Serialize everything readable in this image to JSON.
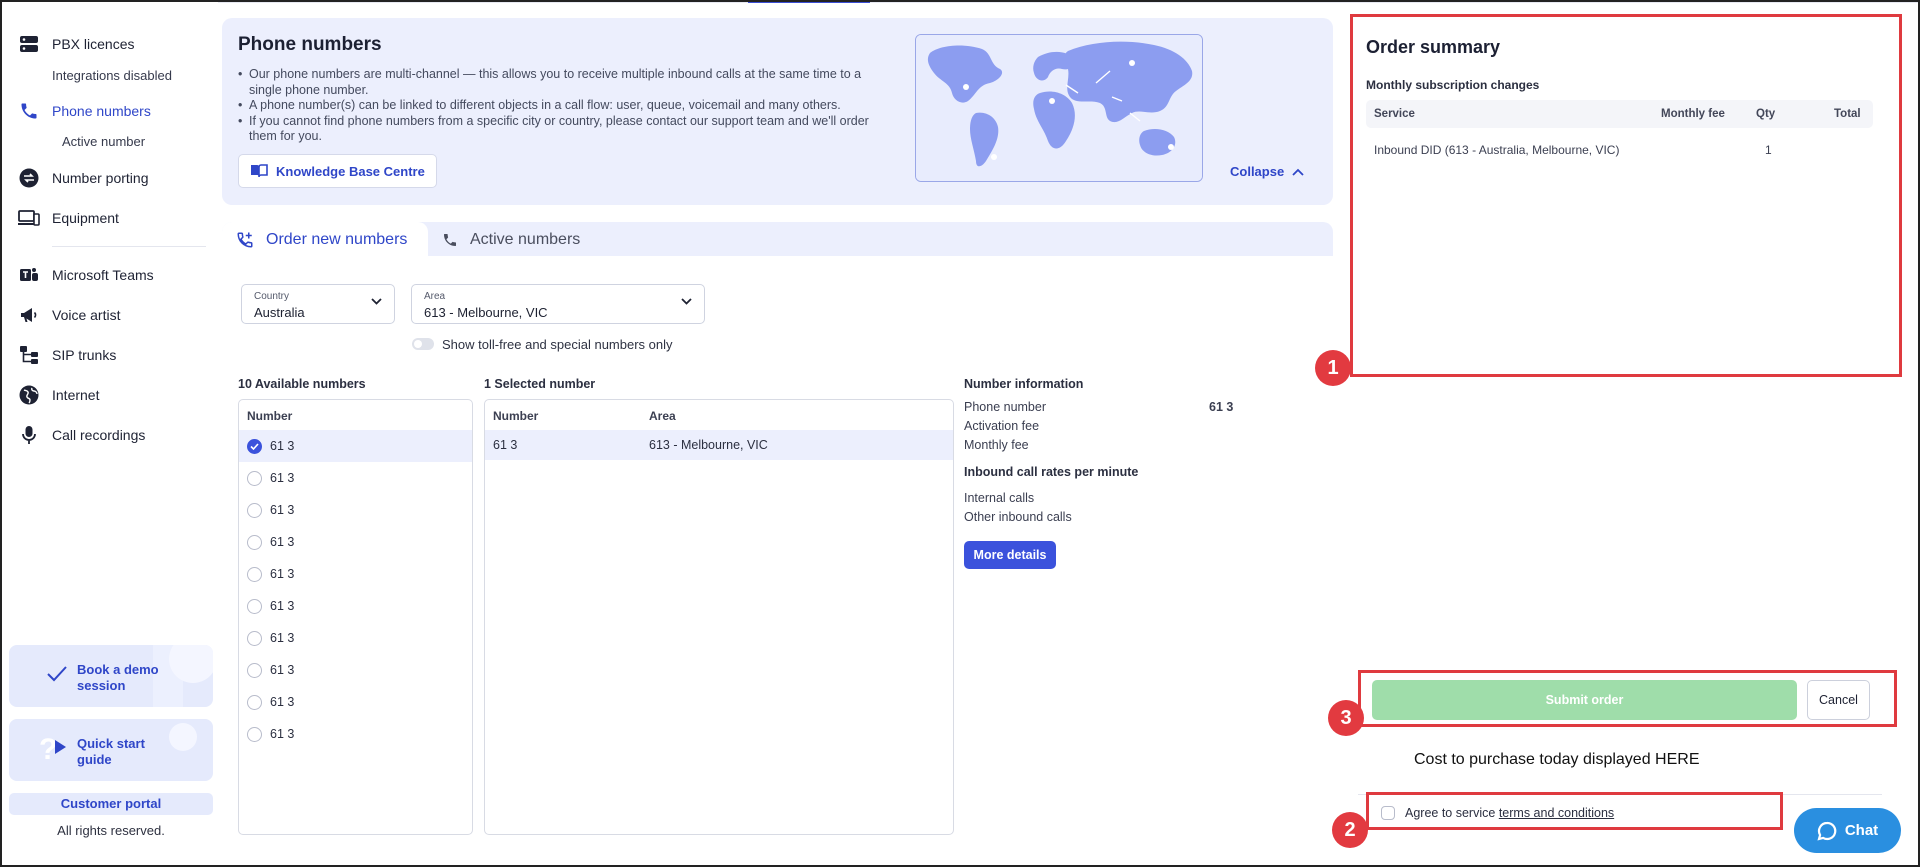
{
  "sidebar": {
    "items": [
      {
        "label": "PBX licences",
        "icon": "server-icon"
      },
      {
        "label": "Phone numbers",
        "icon": "phone-icon"
      },
      {
        "label": "Number porting",
        "icon": "transfer-icon"
      },
      {
        "label": "Equipment",
        "icon": "devices-icon"
      },
      {
        "label": "Microsoft Teams",
        "icon": "teams-icon"
      },
      {
        "label": "Voice artist",
        "icon": "megaphone-icon"
      },
      {
        "label": "SIP trunks",
        "icon": "sitemap-icon"
      },
      {
        "label": "Internet",
        "icon": "globe-icon"
      },
      {
        "label": "Call recordings",
        "icon": "microphone-icon"
      }
    ],
    "sub_integrations": "Integrations disabled",
    "sub_active_number": "Active number",
    "promo_demo": [
      "Book a demo",
      "session"
    ],
    "promo_guide": [
      "Quick start",
      "guide"
    ],
    "customer_portal": "Customer portal",
    "rights": "All rights reserved."
  },
  "info": {
    "title": "Phone numbers",
    "bullets": [
      "Our phone numbers are multi-channel — this allows you to receive multiple inbound calls at the same time to a single phone number.",
      "A phone number(s) can be linked to different objects in a call flow: user, queue, voicemail and many others.",
      "If you cannot find phone numbers from a specific city or country, please contact our support team and we'll order them for you."
    ],
    "kb_button": "Knowledge Base Centre",
    "collapse": "Collapse"
  },
  "tabs": {
    "order_new": "Order new numbers",
    "active": "Active numbers"
  },
  "filters": {
    "country_label": "Country",
    "country_value": "Australia",
    "area_label": "Area",
    "area_value": "613 - Melbourne, VIC",
    "toggle_label": "Show toll-free and special numbers only"
  },
  "available": {
    "title": "10 Available numbers",
    "column": "Number",
    "numbers": [
      "61 3",
      "61 3",
      "61 3",
      "61 3",
      "61 3",
      "61 3",
      "61 3",
      "61 3",
      "61 3",
      "61 3"
    ]
  },
  "selected": {
    "title": "1 Selected number",
    "col_number": "Number",
    "col_area": "Area",
    "row_number": "61 3",
    "row_area": "613 - Melbourne, VIC"
  },
  "number_info": {
    "title": "Number information",
    "phone_label": "Phone number",
    "phone_value": "61 3",
    "activation_label": "Activation fee",
    "monthly_label": "Monthly fee",
    "rates_title": "Inbound call rates per minute",
    "internal_label": "Internal calls",
    "other_label": "Other inbound calls",
    "more_details": "More details"
  },
  "summary": {
    "title": "Order summary",
    "subtitle": "Monthly subscription changes",
    "col_service": "Service",
    "col_fee": "Monthly fee",
    "col_qty": "Qty",
    "col_total": "Total",
    "row_service": "Inbound DID (613 - Australia, Melbourne, VIC)",
    "row_qty": "1"
  },
  "actions": {
    "submit": "Submit order",
    "cancel": "Cancel",
    "cost_note": "Cost to purchase today displayed HERE",
    "agree": "Agree to service",
    "terms_link": "terms and conditions",
    "chat": "Chat"
  },
  "badges": [
    "1",
    "2",
    "3"
  ],
  "colors": {
    "accent": "#3b52dc",
    "annotation_red": "#df3a3f",
    "submit_disabled": "#9fddaa",
    "chat": "#2a8fe0"
  }
}
